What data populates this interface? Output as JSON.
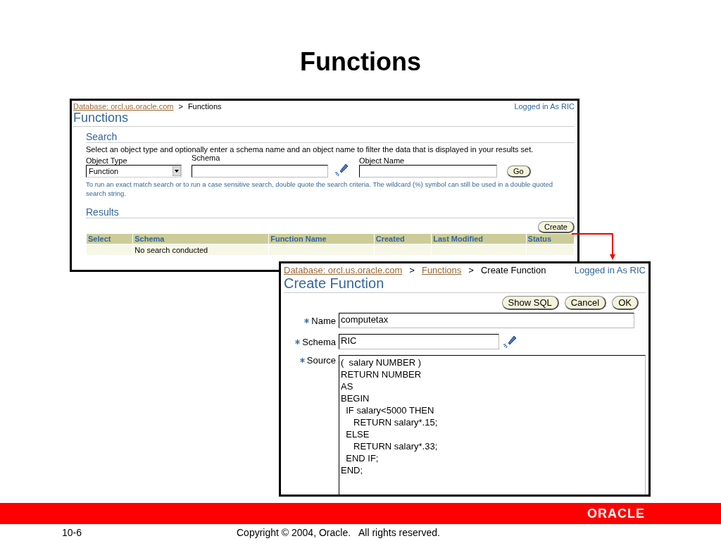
{
  "title": "Functions",
  "functions_page": {
    "breadcrumb": [
      {
        "text": "Database: orcl.us.oracle.com",
        "link": true
      },
      {
        "text": ">",
        "link": false
      },
      {
        "text": "Functions",
        "link": false
      }
    ],
    "logged_in": "Logged in As RIC",
    "heading": "Functions",
    "search": {
      "heading": "Search",
      "instructions": "Select an object type and optionally enter a schema name and an object name to filter the data that is displayed in your results set.",
      "fields": [
        {
          "label": "Object Type",
          "kind": "select",
          "value": "Function"
        },
        {
          "label": "Schema",
          "kind": "lookup"
        },
        {
          "label": "Object Name",
          "kind": "text"
        }
      ],
      "go_button": "Go",
      "hint": "To run an exact match search or to run a case sensitive search, double quote the search criteria. The wildcard (%) symbol can still be used in a double quoted search string."
    },
    "results": {
      "heading": "Results",
      "create_button": "Create",
      "columns": [
        "Select",
        "Schema",
        "Function Name",
        "Created",
        "Last Modified",
        "Status"
      ],
      "rows": [
        [
          "",
          "No search conducted",
          "",
          "",
          "",
          ""
        ]
      ]
    }
  },
  "create_function_page": {
    "breadcrumb": [
      {
        "text": "Database: orcl.us.oracle.com",
        "link": true
      },
      {
        "text": ">",
        "link": false
      },
      {
        "text": "Functions",
        "link": true
      },
      {
        "text": ">",
        "link": false
      },
      {
        "text": "Create Function",
        "link": false
      }
    ],
    "logged_in": "Logged in As RIC",
    "heading": "Create Function",
    "buttons": [
      "Show SQL",
      "Cancel",
      "OK"
    ],
    "fields": [
      {
        "label": "Name",
        "required": true,
        "kind": "text",
        "value": "computetax"
      },
      {
        "label": "Schema",
        "required": true,
        "kind": "lookup",
        "value": "RIC"
      },
      {
        "label": "Source",
        "required": true,
        "kind": "textarea",
        "value": "(  salary NUMBER )\nRETURN NUMBER\nAS\nBEGIN\n  IF salary<5000 THEN\n     RETURN salary*.15;\n  ELSE\n     RETURN salary*.33;\n  END IF;\nEND;"
      }
    ]
  },
  "footer": {
    "logo": "ORACLE",
    "page_number": "10-6",
    "copyright": "Copyright © 2004, Oracle.   All rights reserved."
  }
}
